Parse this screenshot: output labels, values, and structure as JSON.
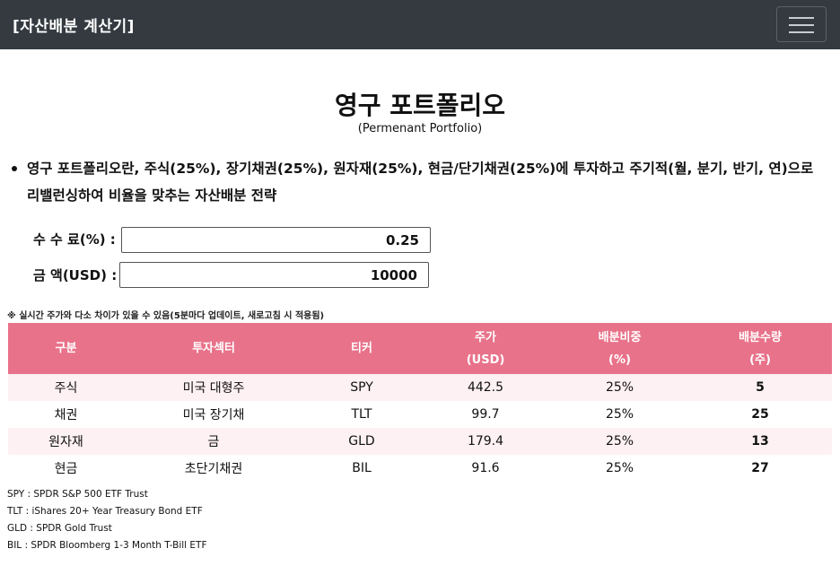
{
  "navbar": {
    "brand": "[자산배분 계산기]",
    "menu_icon": "hamburger-menu-icon"
  },
  "page": {
    "title": "영구 포트폴리오",
    "subtitle": "(Permenant Portfolio)",
    "description": "영구 포트폴리오란, 주식(25%), 장기채권(25%), 원자재(25%), 현금/단기채권(25%)에 투자하고 주기적(월, 분기, 반기, 연)으로 리밸런싱하여 비율을 맞추는 자산배분 전략"
  },
  "form": {
    "fee_label": "수 수 료(%) :",
    "fee_value": "0.25",
    "amount_label": "금 액(USD) :",
    "amount_value": "10000"
  },
  "notice": "※ 실시간 주가와 다소 차이가 있을 수 있음(5분마다 업데이트, 새로고침 시 적용됨)",
  "table": {
    "headers": [
      {
        "line1": "구분",
        "line2": ""
      },
      {
        "line1": "투자섹터",
        "line2": ""
      },
      {
        "line1": "티커",
        "line2": ""
      },
      {
        "line1": "주가",
        "line2": "(USD)"
      },
      {
        "line1": "배분비중",
        "line2": "(%)"
      },
      {
        "line1": "배분수량",
        "line2": "(주)"
      }
    ],
    "rows": [
      {
        "category": "주식",
        "sector": "미국 대형주",
        "ticker": "SPY",
        "price": "442.5",
        "weight": "25%",
        "qty": "5"
      },
      {
        "category": "채권",
        "sector": "미국 장기채",
        "ticker": "TLT",
        "price": "99.7",
        "weight": "25%",
        "qty": "25"
      },
      {
        "category": "원자재",
        "sector": "금",
        "ticker": "GLD",
        "price": "179.4",
        "weight": "25%",
        "qty": "13"
      },
      {
        "category": "현금",
        "sector": "초단기채권",
        "ticker": "BIL",
        "price": "91.6",
        "weight": "25%",
        "qty": "27"
      }
    ]
  },
  "footnotes": [
    "SPY : SPDR S&P 500 ETF Trust",
    "TLT : iShares 20+ Year Treasury Bond ETF",
    "GLD : SPDR Gold Trust",
    "BIL : SPDR Bloomberg 1-3 Month T-Bill ETF"
  ],
  "colors": {
    "navbar": "#343a40",
    "table_header": "#e8728a",
    "row_stripe": "#fdf1f3"
  }
}
